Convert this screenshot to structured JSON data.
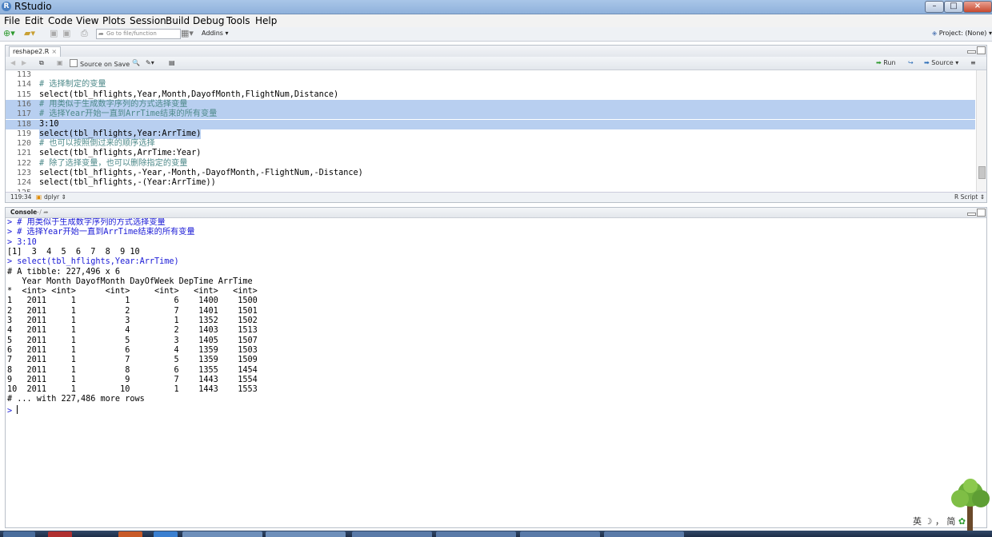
{
  "window": {
    "title": "RStudio"
  },
  "menu": [
    "File",
    "Edit",
    "Code",
    "View",
    "Plots",
    "Session",
    "Build",
    "Debug",
    "Tools",
    "Help"
  ],
  "toolbar": {
    "goto_placeholder": "Go to file/function",
    "addins_label": "Addins",
    "project_label": "Project: (None)"
  },
  "editor": {
    "tab_name": "reshape2.R",
    "source_on_save_label": "Source on Save",
    "run_label": "Run",
    "source_label": "Source",
    "cursor_position": "119:34",
    "context": "dplyr",
    "file_type": "R Script",
    "lines": [
      {
        "num": "113",
        "text": "",
        "kind": "code",
        "selected": false
      },
      {
        "num": "114",
        "text": "# 选择制定的变量",
        "kind": "comment",
        "selected": false
      },
      {
        "num": "115",
        "text": "select(tbl_hflights,Year,Month,DayofMonth,FlightNum,Distance)",
        "kind": "code",
        "selected": false
      },
      {
        "num": "116",
        "text": "# 用类似于生成数字序列的方式选择变量",
        "kind": "comment",
        "selected": true
      },
      {
        "num": "117",
        "text": "# 选择Year开始一直到ArrTime结束的所有变量",
        "kind": "comment",
        "selected": true
      },
      {
        "num": "118",
        "text": "3:10",
        "kind": "number",
        "selected": true
      },
      {
        "num": "119",
        "text": "select(tbl_hflights,Year:ArrTime)",
        "kind": "selend",
        "selected": false
      },
      {
        "num": "120",
        "text": "# 也可以按照倒过来的顺序选择",
        "kind": "comment",
        "selected": false
      },
      {
        "num": "121",
        "text": "select(tbl_hflights,ArrTime:Year)",
        "kind": "code",
        "selected": false
      },
      {
        "num": "122",
        "text": "# 除了选择变量，也可以删除指定的变量",
        "kind": "comment",
        "selected": false
      },
      {
        "num": "123",
        "text": "select(tbl_hflights,-Year,-Month,-DayofMonth,-FlightNum,-Distance)",
        "kind": "code",
        "selected": false
      },
      {
        "num": "124",
        "text": "select(tbl_hflights,-(Year:ArrTime))",
        "kind": "code",
        "selected": false
      },
      {
        "num": "125",
        "text": "",
        "kind": "code",
        "selected": false
      }
    ]
  },
  "console": {
    "title": "Console",
    "path": "~/",
    "lines": [
      {
        "text": "> # 用类似于生成数字序列的方式选择变量",
        "kind": "cmd"
      },
      {
        "text": "> # 选择Year开始一直到ArrTime结束的所有变量",
        "kind": "cmd"
      },
      {
        "text": "> 3:10",
        "kind": "cmd"
      },
      {
        "text": "[1]  3  4  5  6  7  8  9 10",
        "kind": "out"
      },
      {
        "text": "> select(tbl_hflights,Year:ArrTime)",
        "kind": "cmd"
      },
      {
        "text": "# A tibble: 227,496 x 6",
        "kind": "out"
      },
      {
        "text": "   Year Month DayofMonth DayOfWeek DepTime ArrTime",
        "kind": "out"
      },
      {
        "text": "*  <int> <int>      <int>     <int>   <int>   <int>",
        "kind": "out"
      },
      {
        "text": "1   2011     1          1         6    1400    1500",
        "kind": "out"
      },
      {
        "text": "2   2011     1          2         7    1401    1501",
        "kind": "out"
      },
      {
        "text": "3   2011     1          3         1    1352    1502",
        "kind": "out"
      },
      {
        "text": "4   2011     1          4         2    1403    1513",
        "kind": "out"
      },
      {
        "text": "5   2011     1          5         3    1405    1507",
        "kind": "out"
      },
      {
        "text": "6   2011     1          6         4    1359    1503",
        "kind": "out"
      },
      {
        "text": "7   2011     1          7         5    1359    1509",
        "kind": "out"
      },
      {
        "text": "8   2011     1          8         6    1355    1454",
        "kind": "out"
      },
      {
        "text": "9   2011     1          9         7    1443    1554",
        "kind": "out"
      },
      {
        "text": "10  2011     1         10         1    1443    1553",
        "kind": "out"
      },
      {
        "text": "# ... with 227,486 more rows",
        "kind": "out"
      },
      {
        "text": "> ",
        "kind": "prompt"
      }
    ]
  },
  "ime": {
    "label": "英 ☽ ， 简"
  },
  "colors": {
    "selection": "#b8cff0",
    "comment": "#4e8a8a",
    "console_cmd": "#1a1ad6"
  }
}
